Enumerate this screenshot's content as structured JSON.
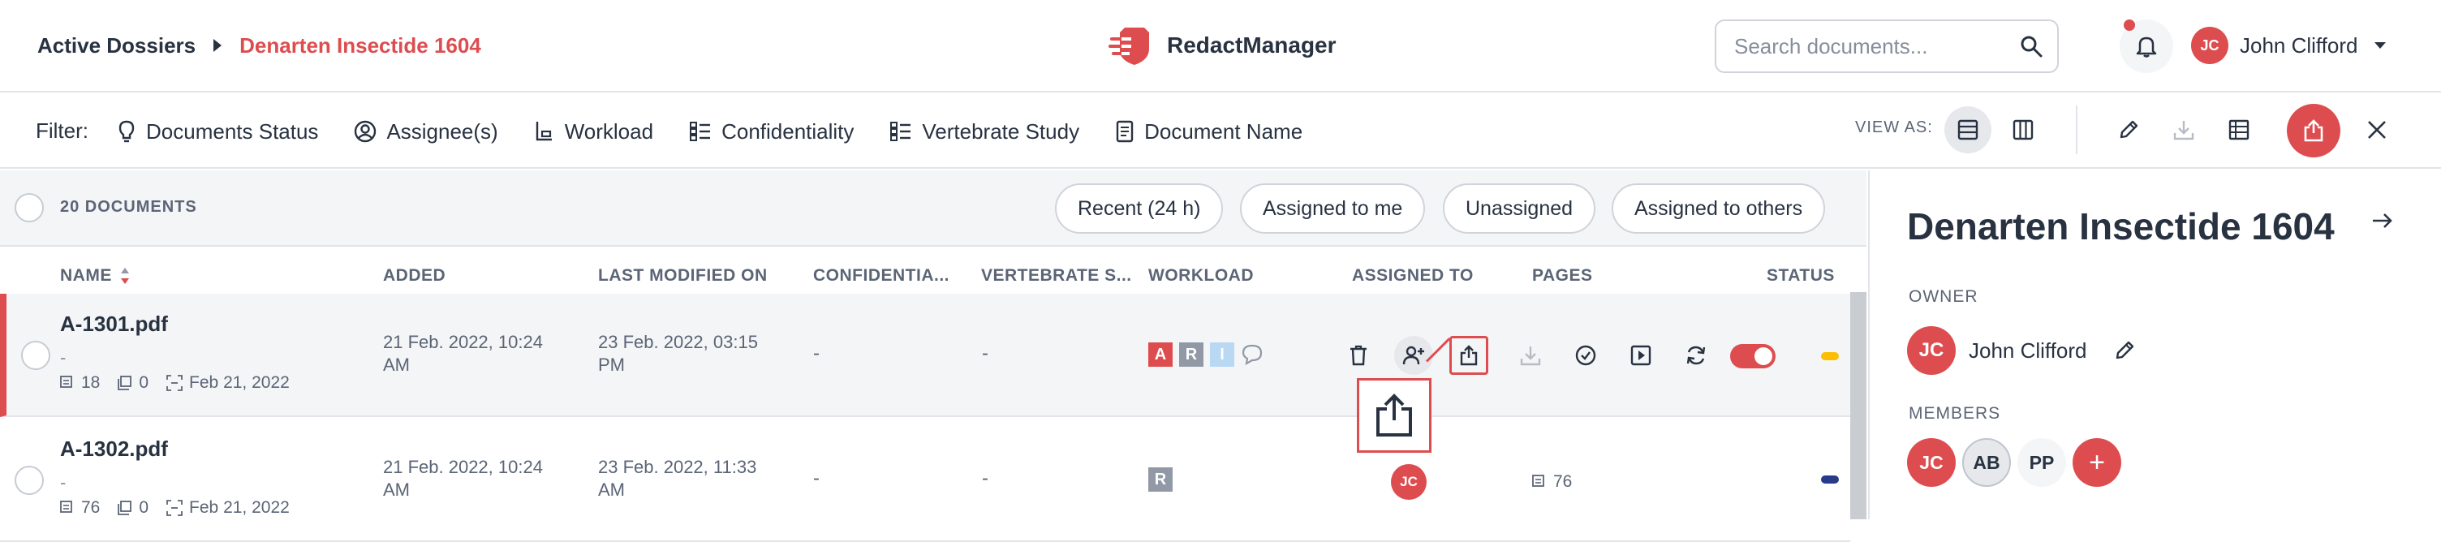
{
  "header": {
    "breadcrumb_root": "Active Dossiers",
    "breadcrumb_current": "Denarten Insectide 1604",
    "brand_name": "RedactManager",
    "search_placeholder": "Search documents...",
    "user_initials": "JC",
    "user_name": "John Clifford"
  },
  "filterbar": {
    "label": "Filter:",
    "filters": [
      "Documents Status",
      "Assignee(s)",
      "Workload",
      "Confidentiality",
      "Vertebrate Study",
      "Document Name"
    ],
    "view_as_label": "VIEW AS:"
  },
  "list": {
    "doc_count": "20 DOCUMENTS",
    "quick_filters": [
      "Recent (24 h)",
      "Assigned to me",
      "Unassigned",
      "Assigned to others"
    ],
    "columns": [
      "NAME",
      "ADDED",
      "LAST MODIFIED ON",
      "CONFIDENTIA...",
      "VERTEBRATE S...",
      "WORKLOAD",
      "ASSIGNED TO",
      "PAGES",
      "STATUS"
    ],
    "rows": [
      {
        "name": "A-1301.pdf",
        "sub": "-",
        "pages_meta": "18",
        "excluded_meta": "0",
        "date_meta": "Feb 21, 2022",
        "added_line1": "21 Feb. 2022, 10:24",
        "added_line2": "AM",
        "modified_line1": "23 Feb. 2022, 03:15",
        "modified_line2": "PM",
        "confidentiality": "-",
        "vertebrate": "-",
        "workload": [
          "A",
          "R",
          "I"
        ],
        "status_color": "#fdbd00"
      },
      {
        "name": "A-1302.pdf",
        "sub": "-",
        "pages_meta": "76",
        "excluded_meta": "0",
        "date_meta": "Feb 21, 2022",
        "added_line1": "21 Feb. 2022, 10:24",
        "added_line2": "AM",
        "modified_line1": "23 Feb. 2022, 11:33",
        "modified_line2": "AM",
        "confidentiality": "-",
        "vertebrate": "-",
        "workload": [
          "R"
        ],
        "assignee_initials": "JC",
        "pages": "76",
        "status_color": "#283a8c"
      }
    ]
  },
  "panel": {
    "title": "Denarten Insectide 1604",
    "owner_label": "OWNER",
    "owner_initials": "JC",
    "owner_name": "John Clifford",
    "members_label": "MEMBERS",
    "members": [
      "JC",
      "AB",
      "PP"
    ],
    "add_member": "+"
  },
  "colors": {
    "accent": "#dd4d50",
    "text": "#283241",
    "muted": "#5b6576",
    "bg_grey": "#f4f5f7"
  }
}
